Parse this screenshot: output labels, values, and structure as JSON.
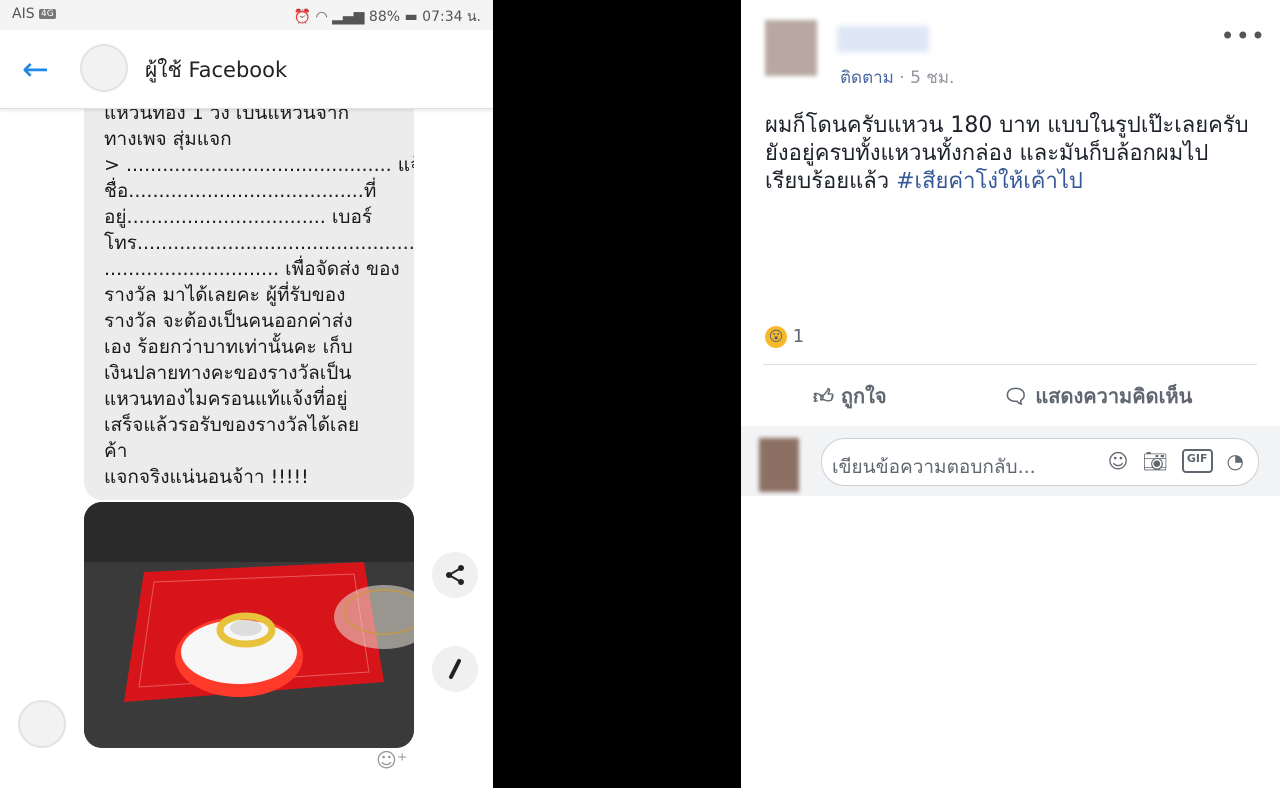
{
  "status": {
    "carrier": "AIS",
    "carrier_badge": "4G",
    "battery": "88%",
    "time": "07:34 น."
  },
  "chat": {
    "contact_name": "ผู้ใช้ Facebook",
    "message_lines": [
      "แหวนทอง 1 วง  เป็นแหวนจาก",
      "ทางเพจ สุ่มแจก",
      "> ............................................ แจ้ง",
      "ชื่อ.......................................ที่",
      "อยู่................................. เบอร์",
      "โทร...............................................",
      "............................. เพื่อจัดส่ง ของ",
      "รางวัล มาได้เลยคะ ผู้ที่รับของ",
      "รางวัล จะต้องเป็นคนออกค่าส่ง",
      "เอง ร้อยกว่าบาทเท่านั้นคะ เก็บ",
      "เงินปลายทางคะของรางวัลเป็น",
      "แหวนทองไมครอนแท้แจ้งที่อยู่",
      "เสร็จแล้วรอรับของรางวัลได้เลย",
      "ค้า",
      "แจกจริงแน่นอนจ้าา  !!!!!"
    ],
    "share_icon": "share-icon",
    "edit_icon": "pencil-icon"
  },
  "post": {
    "follow_label": "ติดตาม",
    "time_ago": "· 5 ชม.",
    "more_label": "•••",
    "text": "ผมก็โดนครับแหวน 180 บาท แบบในรูปเป๊ะเลยครับ ยังอยู่ครบทั้งแหวนทั้งกล่อง และมันก็บล้อกผมไปเรียบร้อยแล้ว ",
    "hashtag": "#เสียค่าโง่ให้เค้าไป",
    "reaction_emoji": "😮",
    "reaction_count": "1",
    "like_label": "ถูกใจ",
    "comment_label": "แสดงความคิดเห็น",
    "reply_placeholder": "เขียนข้อความตอบกลับ...",
    "gif_label": "GIF"
  }
}
